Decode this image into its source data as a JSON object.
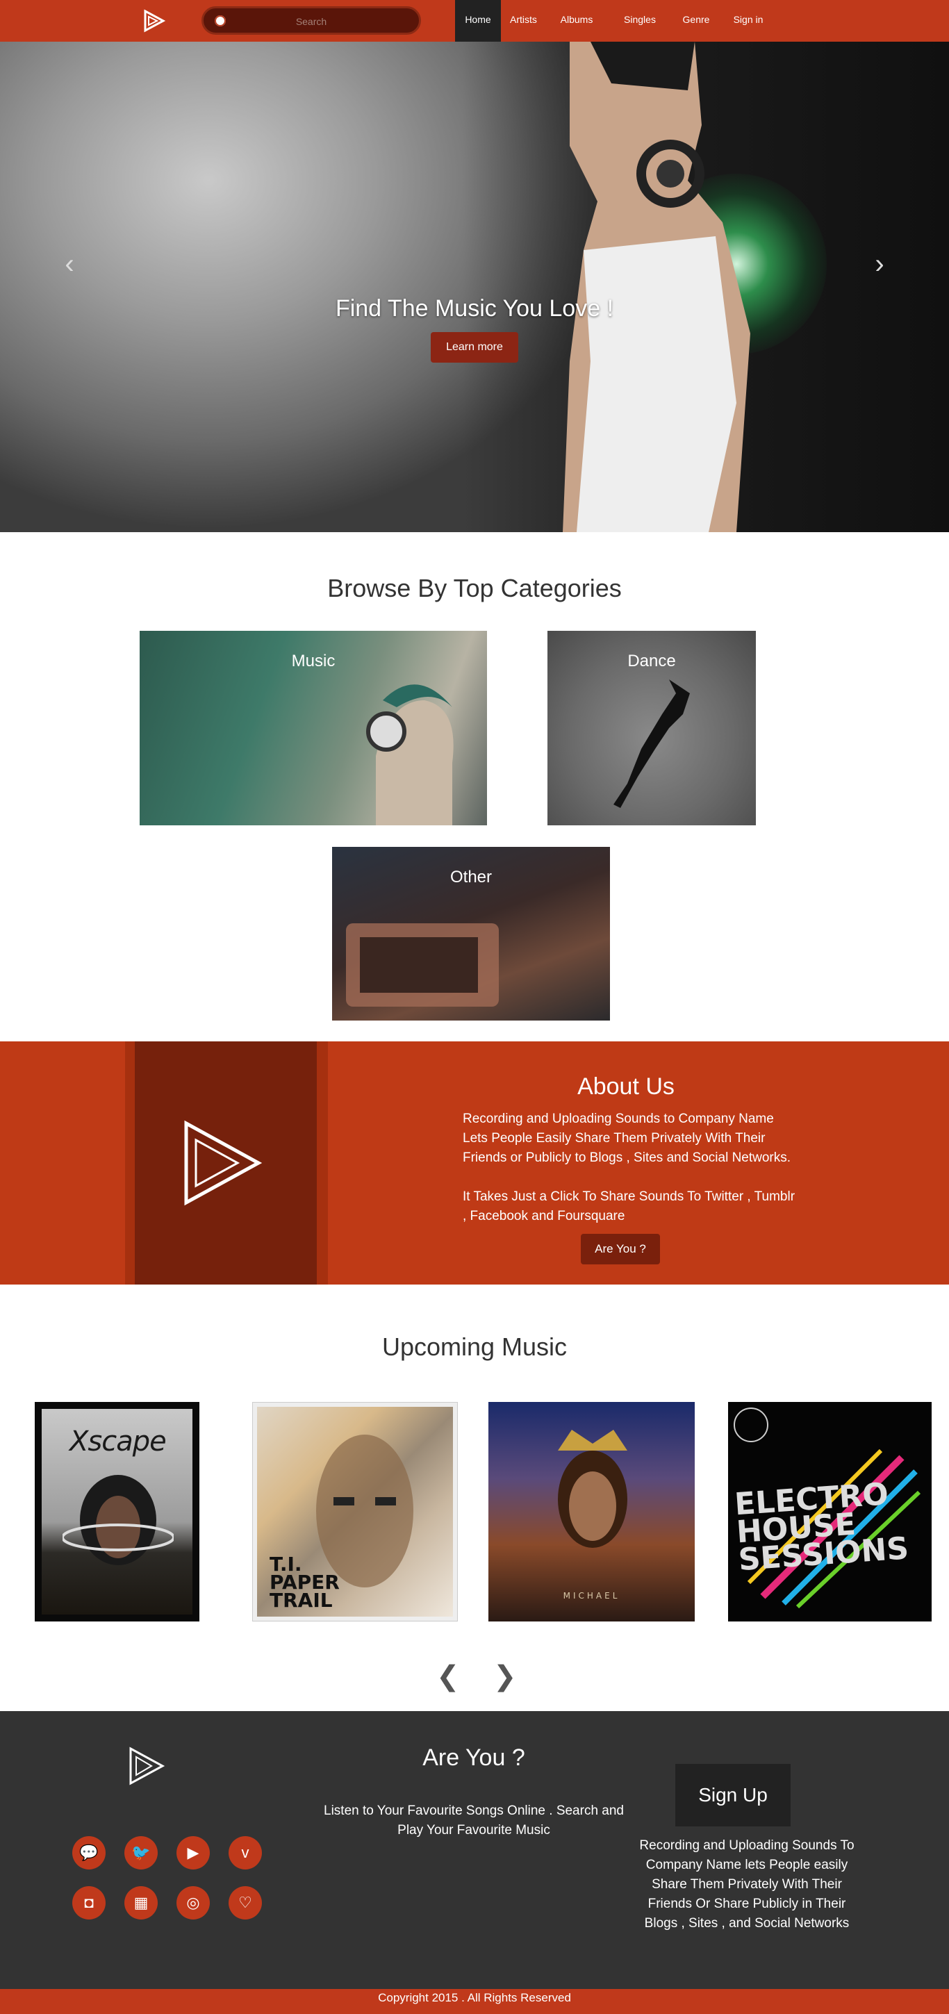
{
  "nav": {
    "search_placeholder": "Search",
    "items": [
      "Home",
      "Artists",
      "Albums",
      "Singles",
      "Genre",
      "Sign in"
    ],
    "active": "Home"
  },
  "hero": {
    "caption": "Find The Music You Love !",
    "button": "Learn more",
    "prev_icon": "chevron-left-icon",
    "next_icon": "chevron-right-icon"
  },
  "categories": {
    "title": "Browse By Top Categories",
    "items": [
      "Music",
      "Dance",
      "Other"
    ]
  },
  "about": {
    "title": "About Us",
    "paragraph1": "Recording and Uploading Sounds to Company Name Lets People Easily Share Them Privately With Their Friends or Publicly to Blogs , Sites and Social Networks.",
    "paragraph2": "It Takes Just a Click To Share Sounds To Twitter , Tumblr , Facebook and Foursquare",
    "button": "Are You ?"
  },
  "upcoming": {
    "title": "Upcoming Music",
    "albums": [
      {
        "cover_text": "Xscape"
      },
      {
        "cover_text": "T.I. PAPER TRAIL"
      },
      {
        "cover_text": "MICHAEL"
      },
      {
        "cover_text": "ELECTRO HOUSE SESSIONS"
      }
    ],
    "prev": "❮",
    "next": "❯"
  },
  "footer": {
    "title": "Are You ?",
    "text": "Listen to Your Favourite Songs Online . Search and Play Your Favourite Music",
    "signup": "Sign Up",
    "right_text": "Recording and Uploading Sounds To Company Name lets People easily Share Them Privately With Their Friends Or Share Publicly in Their Blogs , Sites , and Social Networks",
    "socials": [
      "chat-icon",
      "twitter-icon",
      "youtube-icon",
      "vimeo-icon",
      "instagram-icon",
      "film-icon",
      "camera-icon",
      "heart-icon"
    ],
    "copyright": "Copyright 2015 . All Rights Reserved"
  },
  "colors": {
    "brand": "#c0391b",
    "brand_dark": "#76210c",
    "footer_bg": "#333333"
  }
}
